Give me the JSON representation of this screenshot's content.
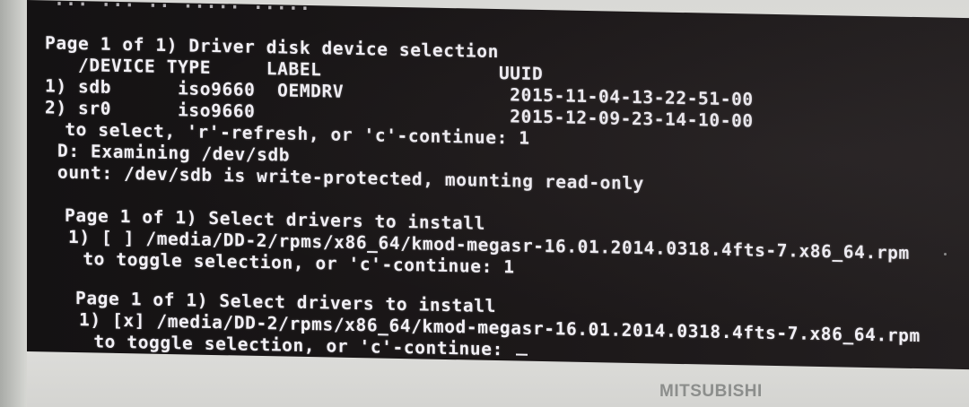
{
  "terminal": {
    "top_partial": "... ... .. ..... .....",
    "section1": {
      "header": "Page 1 of 1) Driver disk device selection",
      "columns": "   /DEVICE TYPE     LABEL                UUID",
      "rows": [
        "1) sdb      iso9660  OEMDRV               2015-11-04-13-22-51-00",
        "2) sr0      iso9660                       2015-12-09-23-14-10-00"
      ],
      "prompt": " to select, 'r'-refresh, or 'c'-continue: 1",
      "examining": "D: Examining /dev/sdb",
      "mount_msg": "ount: /dev/sdb is write-protected, mounting read-only"
    },
    "section2": {
      "header": "Page 1 of 1) Select drivers to install",
      "item": "1) [ ] /media/DD-2/rpms/x86_64/kmod-megasr-16.01.2014.0318.4fts-7.x86_64.rpm",
      "prompt": " to toggle selection, or 'c'-continue: 1"
    },
    "section3": {
      "header": "Page 1 of 1) Select drivers to install",
      "item": "1) [x] /media/DD-2/rpms/x86_64/kmod-megasr-16.01.2014.0318.4fts-7.x86_64.rpm",
      "prompt": " to toggle selection, or 'c'-continue: "
    }
  },
  "monitor": {
    "brand": "MITSUBISHI"
  }
}
